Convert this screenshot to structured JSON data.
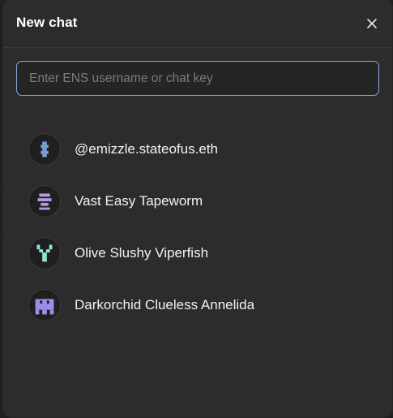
{
  "modal": {
    "title": "New chat",
    "close_icon": "close-icon"
  },
  "search": {
    "placeholder": "Enter ENS username or chat key",
    "value": ""
  },
  "contacts": [
    {
      "name": "@emizzle.stateofus.eth",
      "icon": "identicon-1",
      "color": "#7a9fd0"
    },
    {
      "name": "Vast Easy Tapeworm",
      "icon": "identicon-2",
      "color": "#b89ae6"
    },
    {
      "name": "Olive Slushy Viperfish",
      "icon": "identicon-3",
      "color": "#8ee4d8"
    },
    {
      "name": "Darkorchid Clueless Annelida",
      "icon": "identicon-4",
      "color": "#9c8ee8"
    }
  ],
  "colors": {
    "modal_bg": "#2c2c2c",
    "input_border": "#8fa5de",
    "text": "#f2f2f2"
  }
}
